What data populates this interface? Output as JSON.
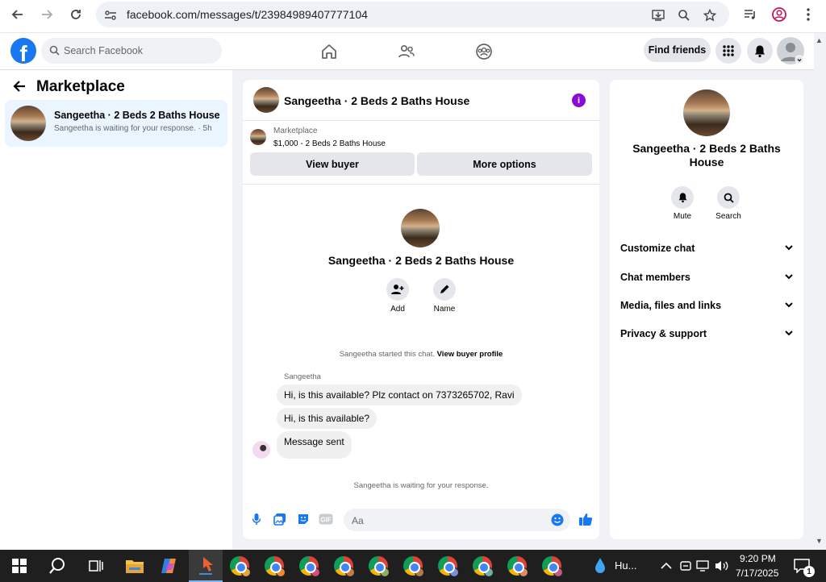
{
  "browser": {
    "url": "facebook.com/messages/t/23984989407777104",
    "icons": [
      "back-icon",
      "forward-icon",
      "reload-icon",
      "site-settings-icon",
      "install-icon",
      "zoom-icon",
      "bookmark-star-icon",
      "media-icon",
      "profile-icon",
      "menu-icon"
    ]
  },
  "fb": {
    "search_placeholder": "Search Facebook",
    "find_friends": "Find friends"
  },
  "left": {
    "title": "Marketplace",
    "conversation": {
      "name": "Sangeetha · 2 Beds 2 Baths House",
      "preview": "Sangeetha is waiting for your response. · 5h"
    }
  },
  "chat": {
    "title": "Sangeetha · 2 Beds 2 Baths House",
    "marketplace_label": "Marketplace",
    "listing": "$1,000 - 2 Beds 2 Baths House",
    "view_buyer": "View buyer",
    "more_options": "More options",
    "center_name": "Sangeetha · 2 Beds 2 Baths House",
    "add_label": "Add",
    "name_label": "Name",
    "started_text": "Sangeetha started this chat.",
    "view_profile": "View buyer profile",
    "sender": "Sangeetha",
    "messages": [
      "Hi, is this available? Plz contact on 7373265702, Ravi",
      "Hi, is this available?",
      "Message sent"
    ],
    "waiting": "Sangeetha is waiting for your response.",
    "compose_placeholder": "Aa"
  },
  "right": {
    "name": "Sangeetha · 2 Beds 2 Baths House",
    "mute": "Mute",
    "search": "Search",
    "sections": [
      "Customize chat",
      "Chat members",
      "Media, files and links",
      "Privacy & support"
    ]
  },
  "taskbar": {
    "weather": "Hu...",
    "time": "9:20 PM",
    "date": "7/17/2025",
    "notif_count": "1"
  },
  "colors": {
    "brand": "#1877f2",
    "info": "#8a0bd6",
    "selected": "#ebf5ff"
  }
}
